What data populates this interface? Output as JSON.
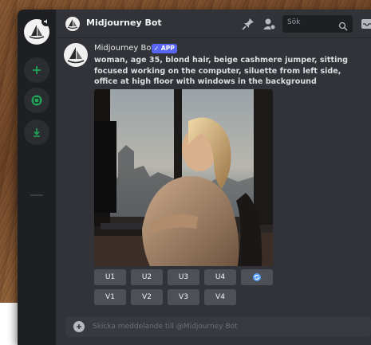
{
  "header": {
    "channel_title": "Midjourney Bot",
    "search_placeholder": "Sök"
  },
  "message": {
    "author": "Midjourney Bot",
    "badge": "✓ APP",
    "prompt": "woman, age 35, blond hair, beige cashmere jumper, sitting focused working on the computer, siluette from left side, office at high floor with windows in the background"
  },
  "buttons": {
    "upscale": [
      "U1",
      "U2",
      "U3",
      "U4"
    ],
    "variation": [
      "V1",
      "V2",
      "V3",
      "V4"
    ],
    "reroll_icon": "refresh-icon"
  },
  "composer": {
    "placeholder": "Skicka meddelande till @Midjourney Bot"
  },
  "colors": {
    "accent": "#5865f2",
    "rail_green": "#23a55a",
    "reroll_blue": "#5da2ff"
  }
}
